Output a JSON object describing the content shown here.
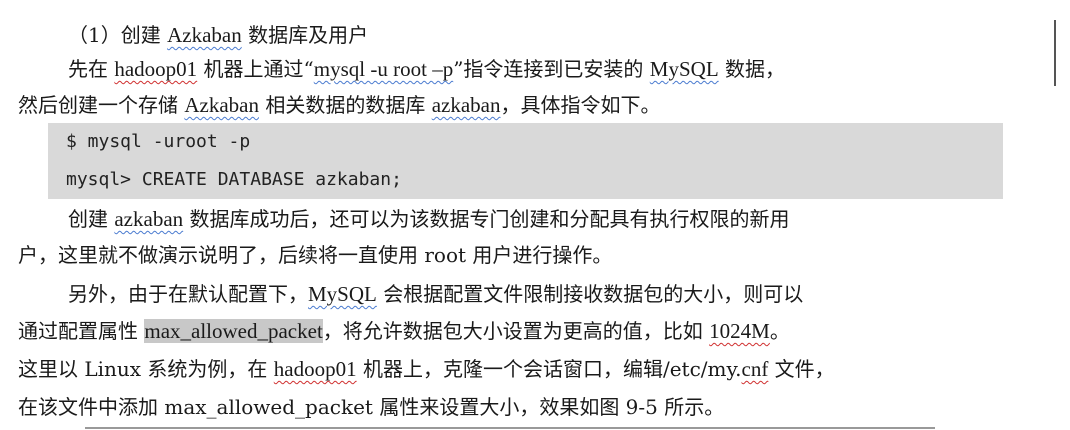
{
  "heading": {
    "prefix": "（1）创建 ",
    "term": "Azkaban",
    "suffix": " 数据库及用户"
  },
  "para1": {
    "line1": [
      "先在 ",
      "hadoop01",
      " 机器上通过“",
      "mysql -u root –p",
      "”指令连接到已安装的 ",
      "MySQL",
      " 数据，"
    ],
    "line2": [
      "然后创建一个存储 ",
      "Azkaban",
      " 相关数据的数据库 ",
      "azkaban",
      "，具体指令如下。"
    ]
  },
  "code": [
    "$ mysql -uroot -p",
    "mysql> CREATE DATABASE azkaban;"
  ],
  "para2": {
    "line1": [
      "创建 ",
      "azkaban",
      " 数据库成功后，还可以为该数据专门创建和分配具有执行权限的新用"
    ],
    "line2": [
      "户，这里就不做演示说明了，后续将一直使用 root 用户进行操作。"
    ]
  },
  "para3": {
    "line1": [
      "另外，由于在默认配置下，",
      "MySQL",
      " 会根据配置文件限制接收数据包的大小，则可以"
    ],
    "line2": [
      "通过配置属性 ",
      "max_allowed_packet",
      "，将允许数据包大小设置为更高的值，比如 ",
      "1024M",
      "。"
    ],
    "line3": [
      "这里以 Linux 系统为例，在 ",
      "hadoop01",
      " 机器上，克隆一个会话窗口，编辑/etc/my.",
      "cnf",
      " 文件，"
    ],
    "line4": [
      "在该文件中添加 max_allowed_packet 属性来设置大小，效果如图 9-5 所示。"
    ]
  }
}
